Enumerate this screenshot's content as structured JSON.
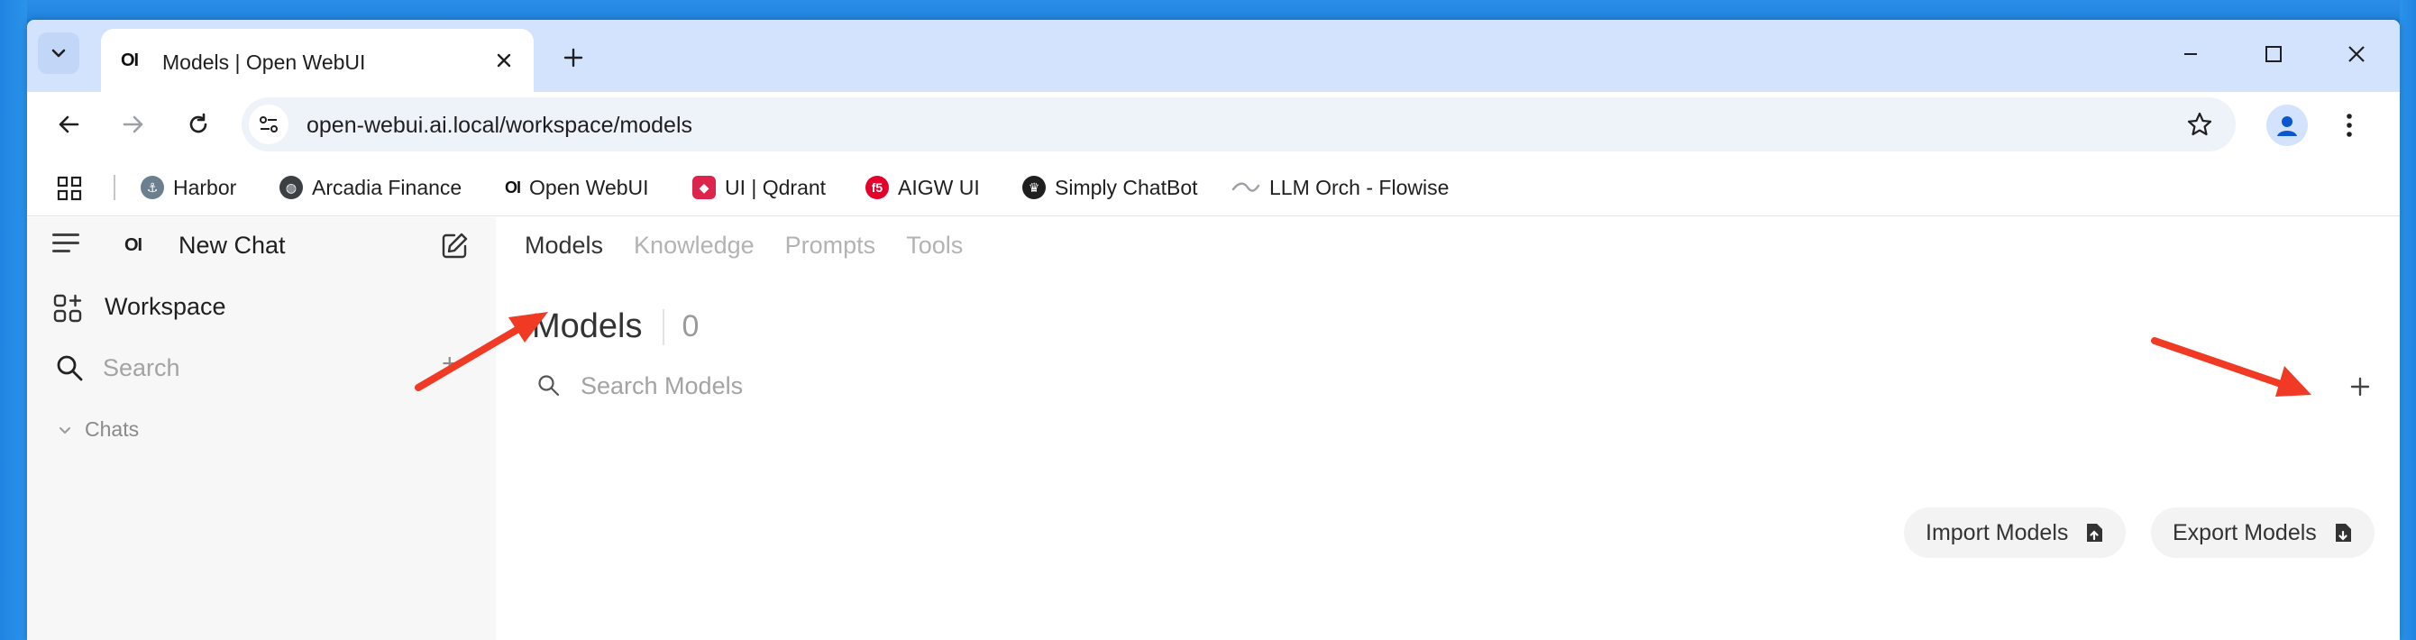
{
  "browser": {
    "tab": {
      "favicon": "OI",
      "title": "Models | Open WebUI"
    },
    "url": "open-webui.ai.local/workspace/models",
    "bookmarks": [
      {
        "label": "Harbor",
        "icon": "harbor-icon",
        "color": "#6b7f8e"
      },
      {
        "label": "Arcadia Finance",
        "icon": "globe-icon",
        "color": "#3c4043"
      },
      {
        "label": "Open WebUI",
        "icon": "OI",
        "color": "#111111"
      },
      {
        "label": "UI | Qdrant",
        "icon": "qdrant-icon",
        "color": "#dc244c"
      },
      {
        "label": "AIGW UI",
        "icon": "f5-icon",
        "color": "#e4002b"
      },
      {
        "label": "Simply ChatBot",
        "icon": "crown-icon",
        "color": "#1f1f1f"
      },
      {
        "label": "LLM Orch - Flowise",
        "icon": "wave-icon",
        "color": "#9aa0a6"
      }
    ]
  },
  "sidebar": {
    "brand": "OI",
    "new_chat": "New Chat",
    "workspace": "Workspace",
    "search": "Search",
    "chats": "Chats"
  },
  "main": {
    "tabs": [
      {
        "label": "Models",
        "active": true
      },
      {
        "label": "Knowledge",
        "active": false
      },
      {
        "label": "Prompts",
        "active": false
      },
      {
        "label": "Tools",
        "active": false
      }
    ],
    "heading": "Models",
    "count": "0",
    "search_placeholder": "Search Models",
    "import_label": "Import Models",
    "export_label": "Export Models"
  },
  "colors": {
    "annotation_arrow": "#f03a24",
    "tabstrip": "#d3e3fd"
  }
}
